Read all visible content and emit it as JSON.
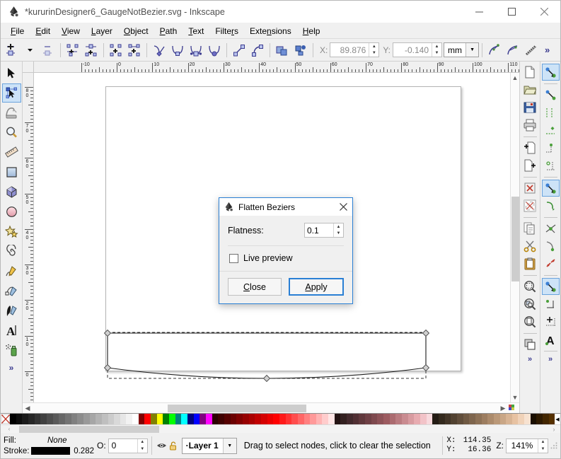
{
  "window": {
    "title": "*kururinDesigner6_GaugeNotBezier.svg - Inkscape",
    "app_icon": "inkscape-logo-icon",
    "minimize_label": "—",
    "maximize_label": "□",
    "close_label": "✕"
  },
  "menubar": {
    "items": [
      {
        "label": "File",
        "mnemonic": "F"
      },
      {
        "label": "Edit",
        "mnemonic": "E"
      },
      {
        "label": "View",
        "mnemonic": "V"
      },
      {
        "label": "Layer",
        "mnemonic": "L"
      },
      {
        "label": "Object",
        "mnemonic": "O"
      },
      {
        "label": "Path",
        "mnemonic": "P"
      },
      {
        "label": "Text",
        "mnemonic": "T"
      },
      {
        "label": "Filters",
        "mnemonic": "r"
      },
      {
        "label": "Extensions",
        "mnemonic": "n"
      },
      {
        "label": "Help",
        "mnemonic": "H"
      }
    ]
  },
  "tool_controls": {
    "buttons": [
      "insert-node-icon",
      "insert-node-dropdown-icon",
      "delete-node-icon",
      "break-path-icon",
      "join-nodes-icon",
      "join-segment-icon",
      "delete-segment-icon",
      "node-cusp-icon",
      "node-smooth-icon",
      "node-symmetric-icon",
      "node-auto-icon",
      "segment-line-icon",
      "segment-curve-icon",
      "object-to-path-icon",
      "stroke-to-path-icon"
    ],
    "x_label": "X:",
    "x_value": "89.876",
    "y_label": "Y:",
    "y_value": "-0.140",
    "unit_value": "mm",
    "right_buttons": [
      "show-transform-handles-icon",
      "show-bezier-handles-icon",
      "show-path-outline-icon"
    ],
    "overflow_label": "»"
  },
  "toolbox": {
    "tools": [
      {
        "name": "selector-tool",
        "icon": "arrow-pointer-icon",
        "selected": false
      },
      {
        "name": "node-tool",
        "icon": "node-editor-icon",
        "selected": true
      },
      {
        "name": "tweak-tool",
        "icon": "tweak-icon",
        "selected": false
      },
      {
        "name": "zoom-tool",
        "icon": "magnifier-icon",
        "selected": false
      },
      {
        "name": "measure-tool",
        "icon": "ruler-icon",
        "selected": false
      },
      {
        "name": "rectangle-tool",
        "icon": "rectangle-icon",
        "selected": false
      },
      {
        "name": "box3d-tool",
        "icon": "cube-3d-icon",
        "selected": false
      },
      {
        "name": "ellipse-tool",
        "icon": "ellipse-icon",
        "selected": false
      },
      {
        "name": "star-tool",
        "icon": "star-icon",
        "selected": false
      },
      {
        "name": "spiral-tool",
        "icon": "spiral-icon",
        "selected": false
      },
      {
        "name": "pencil-tool",
        "icon": "pencil-icon",
        "selected": false
      },
      {
        "name": "bezier-tool",
        "icon": "pen-bezier-icon",
        "selected": false
      },
      {
        "name": "calligraphy-tool",
        "icon": "calligraphy-pen-icon",
        "selected": false
      },
      {
        "name": "text-tool",
        "icon": "text-a-icon",
        "selected": false
      },
      {
        "name": "spray-tool",
        "icon": "spray-can-icon",
        "selected": false
      }
    ],
    "overflow_label": "»"
  },
  "commands_bar": {
    "items": [
      "new-document-icon",
      "open-document-icon",
      "save-document-icon",
      "print-document-icon",
      "import-icon",
      "export-icon",
      "undo-history-icon",
      "transparency-grid-icon",
      "duplicate-icon",
      "cut-scissors-icon",
      "paste-clipboard-icon",
      "zoom-selection-icon",
      "zoom-drawing-icon",
      "zoom-page-icon",
      "objects-panel-icon"
    ],
    "overflow_label": "»"
  },
  "snap_bar": {
    "items": [
      "enable-snapping-icon",
      "snap-bounding-box-icon",
      "snap-bbox-edges-icon",
      "snap-bbox-corners-icon",
      "snap-bbox-edge-midpoints-icon",
      "snap-bbox-centers-icon",
      "snap-nodes-icon",
      "snap-paths-icon",
      "snap-path-intersections-icon",
      "snap-cusp-nodes-icon",
      "snap-smooth-nodes-icon",
      "snap-line-midpoints-icon",
      "snap-object-centers-icon",
      "snap-rotation-centers-icon",
      "snap-text-baseline-icon",
      "snap-page-border-icon",
      "snap-grid-icon",
      "snap-guides-icon"
    ],
    "selected": [
      "enable-snapping-icon",
      "snap-nodes-icon",
      "snap-smooth-nodes-icon"
    ],
    "overflow_label": "»"
  },
  "rulers": {
    "unit": "mm",
    "horizontal_labels": [
      "-10",
      "0",
      "10",
      "20",
      "30",
      "40",
      "50",
      "60",
      "70",
      "80",
      "90",
      "100",
      "110"
    ],
    "vertical_labels": [
      "80",
      "70",
      "60",
      "50",
      "40",
      "30",
      "20",
      "10",
      "0"
    ]
  },
  "canvas": {
    "page_border_color": "#b4b4b4",
    "selection_stroke": "#000000",
    "node_marker_color": "#c8c8c8"
  },
  "dialog": {
    "title": "Flatten Beziers",
    "icon": "inkscape-logo-icon",
    "close_label": "✕",
    "flatness_label": "Flatness:",
    "flatness_value": "0.1",
    "live_preview_label": "Live preview",
    "live_preview_checked": false,
    "close_button": "Close",
    "close_button_mnemonic": "C",
    "apply_button": "Apply",
    "apply_button_mnemonic": "A",
    "accent_color": "#2a7fd4"
  },
  "palette": {
    "none_label": "X",
    "left_arrow": "‹",
    "right_arrow": "›",
    "colors": [
      "#000000",
      "#0d0d0d",
      "#1a1a1a",
      "#262626",
      "#333333",
      "#404040",
      "#4d4d4d",
      "#595959",
      "#666666",
      "#737373",
      "#808080",
      "#8c8c8c",
      "#999999",
      "#a6a6a6",
      "#b3b3b3",
      "#bfbfbf",
      "#cccccc",
      "#d9d9d9",
      "#e6e6e6",
      "#f2f2f2",
      "#ffffff",
      "#800000",
      "#ff0000",
      "#808000",
      "#ffff00",
      "#008000",
      "#00ff00",
      "#008080",
      "#00ffff",
      "#000080",
      "#0000ff",
      "#800080",
      "#ff00ff",
      "#2b0000",
      "#3f0000",
      "#550000",
      "#6b0000",
      "#800000",
      "#960000",
      "#aa0000",
      "#c00000",
      "#d50000",
      "#ea0000",
      "#ff0000",
      "#ff1a1a",
      "#ff3333",
      "#ff4d4d",
      "#ff6666",
      "#ff8080",
      "#ff9999",
      "#ffb3b3",
      "#ffcccc",
      "#ffe6e6",
      "#241414",
      "#332020",
      "#42292c",
      "#512f33",
      "#60383c",
      "#6f4045",
      "#7e494e",
      "#8d5257",
      "#9c5b60",
      "#ab6b70",
      "#ba7b80",
      "#c98b90",
      "#d89ba0",
      "#e7abb0",
      "#f2c3c8",
      "#f8dade",
      "#241c14",
      "#33291d",
      "#423527",
      "#514130",
      "#604d3a",
      "#6f5943",
      "#7e654d",
      "#8d7156",
      "#9c7d60",
      "#ab8a6b",
      "#ba9878",
      "#c9a686",
      "#d8b494",
      "#e7c2a2",
      "#f0d2b8",
      "#f7e2d0",
      "#1a0f00",
      "#2e1a00",
      "#422600",
      "#563100"
    ]
  },
  "statusbar": {
    "fill_label": "Fill:",
    "fill_value": "None",
    "stroke_label": "Stroke:",
    "stroke_color": "#000000",
    "stroke_width": "0.282",
    "opacity_label": "O:",
    "opacity_value": "0",
    "layer_visibility_icon": "eye-icon",
    "layer_lock_icon": "unlock-icon",
    "layer_name": "Layer 1",
    "message": "Drag to select nodes, click to clear the selection",
    "x_label": "X:",
    "x_value": "114.35",
    "y_label": "Y:",
    "y_value": "16.36",
    "zoom_label": "Z:",
    "zoom_value": "141%"
  }
}
